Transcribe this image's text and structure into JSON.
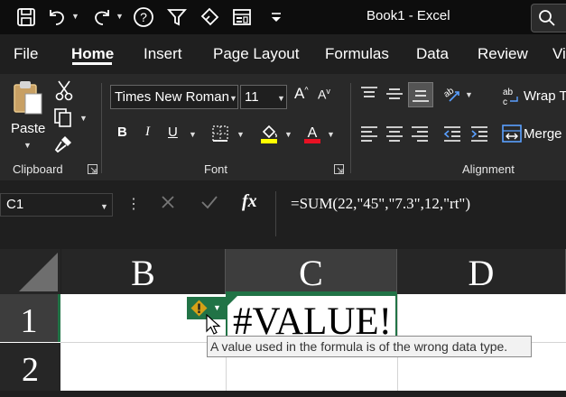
{
  "titlebar": {
    "book_title": "Book1  -  Excel",
    "icons": [
      "save-icon",
      "undo-icon",
      "redo-icon",
      "help-icon",
      "filter-icon",
      "eraser-icon",
      "form-icon",
      "customize-qat-icon",
      "search-icon"
    ]
  },
  "tabs": [
    "File",
    "Home",
    "Insert",
    "Page Layout",
    "Formulas",
    "Data",
    "Review",
    "Vi"
  ],
  "active_tab": "Home",
  "ribbon": {
    "clipboard": {
      "paste_label": "Paste",
      "group_label": "Clipboard"
    },
    "font": {
      "name": "Times New Roman",
      "size": "11",
      "group_label": "Font",
      "bold": "B",
      "italic": "I",
      "underline": "U"
    },
    "alignment": {
      "wrap_label": "Wrap T",
      "merge_label": "Merge",
      "group_label": "Alignment"
    }
  },
  "formula_bar": {
    "name_box": "C1",
    "fx": "fx",
    "formula": "=SUM(22,\"45\",\"7.3\",12,\"rt\")"
  },
  "grid": {
    "columns": [
      "B",
      "C",
      "D"
    ],
    "rows": [
      "1",
      "2"
    ],
    "selected_cell": "C1",
    "cells": {
      "C1": "#VALUE!"
    }
  },
  "error_tooltip": "A value used in the formula is of the wrong data type.",
  "colors": {
    "accent_green": "#217346",
    "font_color_red": "#e81123",
    "highlight_yellow": "#ffff00",
    "warning_gold": "#d4a017"
  }
}
